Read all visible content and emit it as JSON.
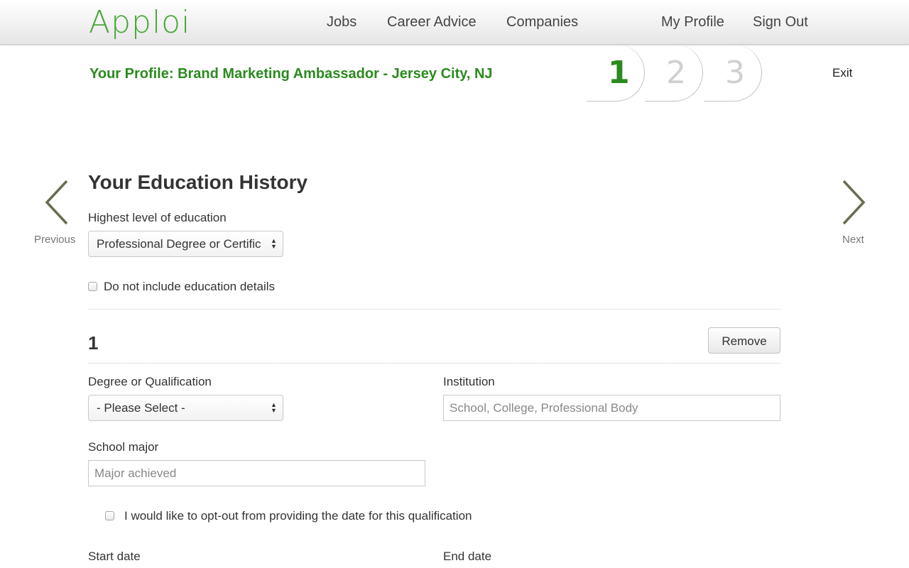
{
  "colors": {
    "brand_green": "#2b8a1e",
    "logo_green": "#49a63a",
    "arrow_olive": "#6b6b52",
    "step_inactive": "#d0d0d0"
  },
  "nav": {
    "logo": "Apploi",
    "links": [
      {
        "label": "Jobs"
      },
      {
        "label": "Career Advice"
      },
      {
        "label": "Companies"
      }
    ],
    "account": [
      {
        "label": "My Profile"
      },
      {
        "label": "Sign Out"
      }
    ]
  },
  "profile": {
    "title": "Your Profile: Brand Marketing Ambassador - Jersey City, NJ",
    "steps": [
      {
        "number": "1",
        "active": true
      },
      {
        "number": "2",
        "active": false
      },
      {
        "number": "3",
        "active": false
      }
    ],
    "exit_label": "Exit"
  },
  "pager": {
    "previous_label": "Previous",
    "next_label": "Next",
    "previous_icon": "chevron-left-icon",
    "next_icon": "chevron-right-icon"
  },
  "form": {
    "heading": "Your Education History",
    "highest_level_label": "Highest level of education",
    "highest_level_value": "Professional Degree or Certific",
    "no_education_label": "Do not include education details",
    "entry": {
      "number": "1",
      "remove_label": "Remove",
      "degree_label": "Degree or Qualification",
      "degree_value": "- Please Select -",
      "institution_label": "Institution",
      "institution_placeholder": "School, College, Professional Body",
      "major_label": "School major",
      "major_placeholder": "Major achieved",
      "opt_out_label": "I would like to opt-out from providing the date for this qualification",
      "start_date_label": "Start date",
      "end_date_label": "End date"
    }
  }
}
